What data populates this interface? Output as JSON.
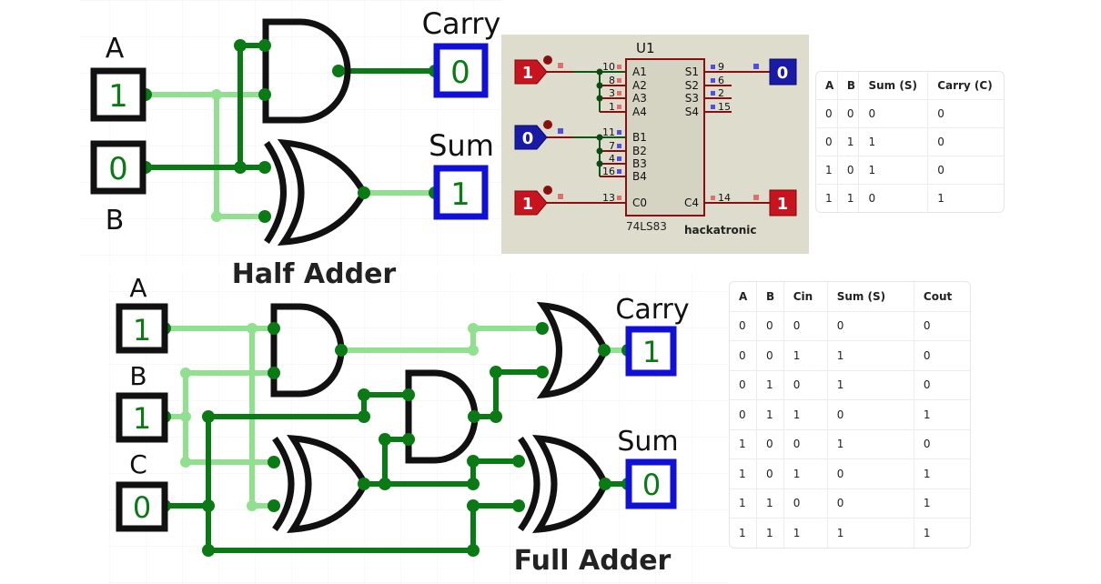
{
  "half_adder": {
    "title": "Half Adder",
    "inputs": [
      {
        "label": "A",
        "value": "1"
      },
      {
        "label": "B",
        "value": "0"
      }
    ],
    "outputs": [
      {
        "label": "Carry",
        "value": "0"
      },
      {
        "label": "Sum",
        "value": "1"
      }
    ],
    "gates": [
      "AND",
      "XOR"
    ]
  },
  "full_adder": {
    "title": "Full Adder",
    "inputs": [
      {
        "label": "A",
        "value": "1"
      },
      {
        "label": "B",
        "value": "1"
      },
      {
        "label": "C",
        "value": "0"
      }
    ],
    "outputs": [
      {
        "label": "Carry",
        "value": "1"
      },
      {
        "label": "Sum",
        "value": "0"
      }
    ],
    "gates": [
      "AND",
      "AND",
      "XOR",
      "XOR",
      "OR"
    ]
  },
  "ic_panel": {
    "designator": "U1",
    "part": "74LS83",
    "brand": "hackatronic",
    "inputs": [
      {
        "value": "1",
        "state": "high"
      },
      {
        "value": "0",
        "state": "low"
      },
      {
        "value": "1",
        "state": "high"
      }
    ],
    "outputs": [
      {
        "value": "0",
        "state": "low"
      },
      {
        "value": "1",
        "state": "high"
      }
    ],
    "left_pins": [
      {
        "num": "10",
        "name": "A1"
      },
      {
        "num": "8",
        "name": "A2"
      },
      {
        "num": "3",
        "name": "A3"
      },
      {
        "num": "1",
        "name": "A4"
      },
      {
        "num": "11",
        "name": "B1"
      },
      {
        "num": "7",
        "name": "B2"
      },
      {
        "num": "4",
        "name": "B3"
      },
      {
        "num": "16",
        "name": "B4"
      },
      {
        "num": "13",
        "name": "C0"
      }
    ],
    "right_pins": [
      {
        "num": "9",
        "name": "S1"
      },
      {
        "num": "6",
        "name": "S2"
      },
      {
        "num": "2",
        "name": "S3"
      },
      {
        "num": "15",
        "name": "S4"
      },
      {
        "num": "14",
        "name": "C4"
      }
    ]
  },
  "half_adder_table": {
    "headers": [
      "A",
      "B",
      "Sum (S)",
      "Carry (C)"
    ],
    "rows": [
      [
        "0",
        "0",
        "0",
        "0"
      ],
      [
        "0",
        "1",
        "1",
        "0"
      ],
      [
        "1",
        "0",
        "1",
        "0"
      ],
      [
        "1",
        "1",
        "0",
        "1"
      ]
    ]
  },
  "full_adder_table": {
    "headers": [
      "A",
      "B",
      "Cin",
      "Sum (S)",
      "Cout"
    ],
    "rows": [
      [
        "0",
        "0",
        "0",
        "0",
        "0"
      ],
      [
        "0",
        "0",
        "1",
        "1",
        "0"
      ],
      [
        "0",
        "1",
        "0",
        "1",
        "0"
      ],
      [
        "0",
        "1",
        "1",
        "0",
        "1"
      ],
      [
        "1",
        "0",
        "0",
        "1",
        "0"
      ],
      [
        "1",
        "0",
        "1",
        "0",
        "1"
      ],
      [
        "1",
        "1",
        "0",
        "0",
        "1"
      ],
      [
        "1",
        "1",
        "1",
        "1",
        "1"
      ]
    ]
  },
  "colors": {
    "wire_high": "#0a7a14",
    "wire_low": "#90e090",
    "input_box": "#111111",
    "output_box": "#1010d8",
    "gate": "#111111",
    "ic_bg": "#dddccd",
    "ic_wire": "#8a1010",
    "probe_high": "#c8141e",
    "probe_low": "#1a1aa8"
  }
}
